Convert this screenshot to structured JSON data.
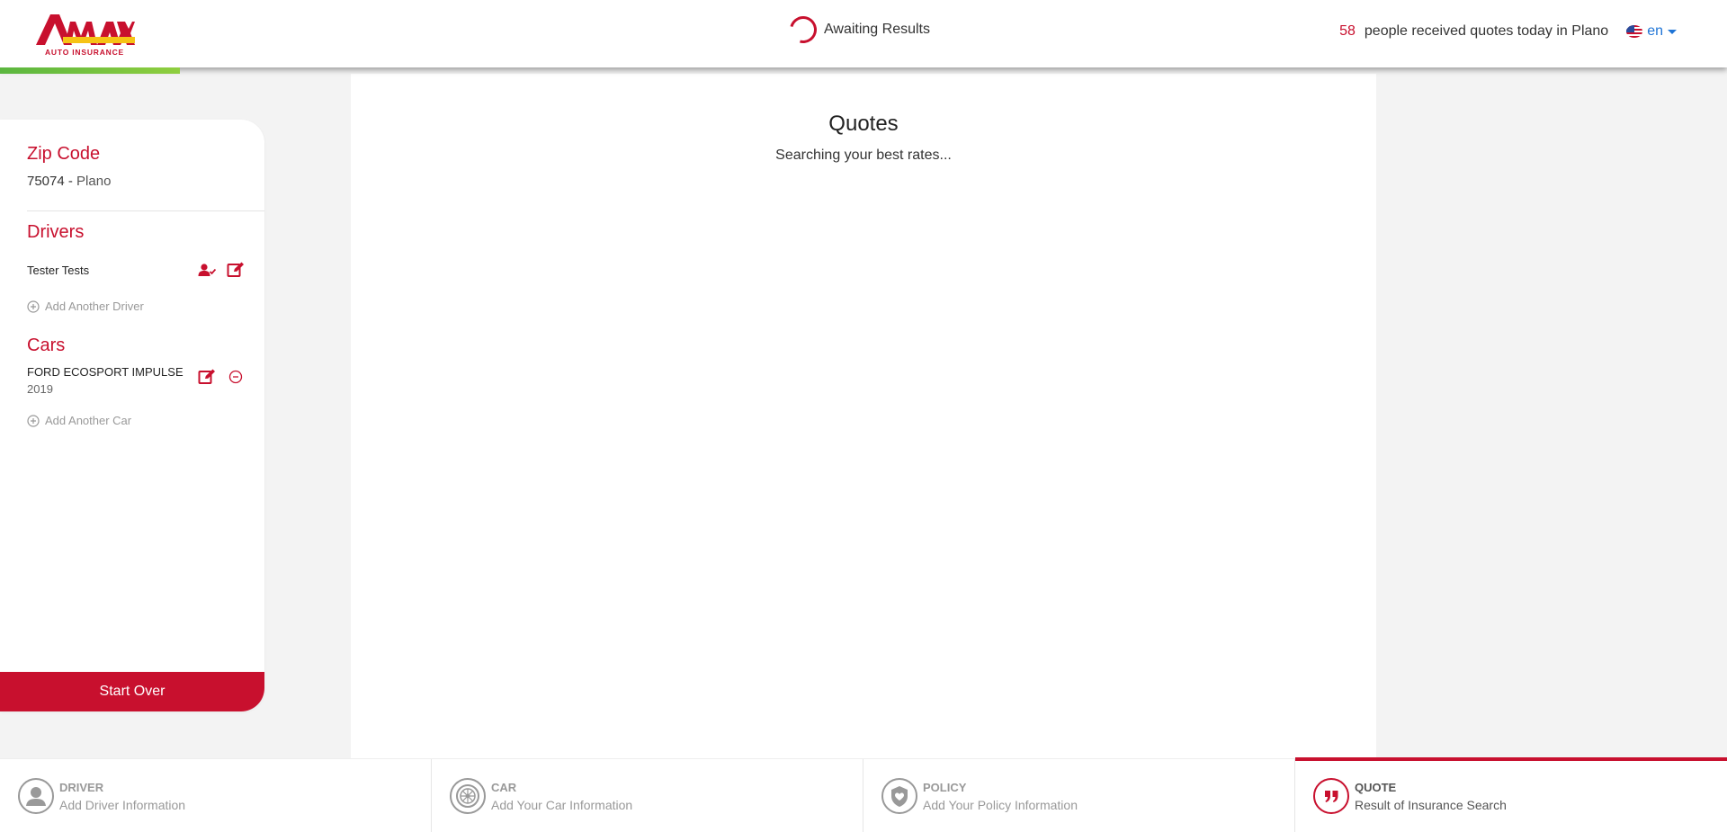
{
  "header": {
    "logo_text": "AMAX",
    "logo_sub": "AUTO INSURANCE",
    "status": "Awaiting Results",
    "people_count": "58",
    "people_text": "people received quotes today in Plano",
    "language": "en"
  },
  "sidebar": {
    "zip_title": "Zip Code",
    "zip_code": "75074 -",
    "zip_city": "Plano",
    "drivers_title": "Drivers",
    "driver_name": "Tester Tests",
    "add_driver": "Add Another Driver",
    "cars_title": "Cars",
    "car_name": "FORD ECOSPORT IMPULSE",
    "car_year": "2019",
    "add_car": "Add Another Car",
    "start_over": "Start Over"
  },
  "main": {
    "title": "Quotes",
    "subtitle": "Searching your best rates..."
  },
  "steps": [
    {
      "title": "DRIVER",
      "sub": "Add Driver Information",
      "icon": "person-icon"
    },
    {
      "title": "CAR",
      "sub": "Add Your Car Information",
      "icon": "wheel-icon"
    },
    {
      "title": "POLICY",
      "sub": "Add Your Policy Information",
      "icon": "shield-icon"
    },
    {
      "title": "QUOTE",
      "sub": "Result of Insurance Search",
      "icon": "quote-icon"
    }
  ],
  "colors": {
    "brand": "#c8102e",
    "progress": "#5bb63f",
    "link": "#1e74d6"
  }
}
